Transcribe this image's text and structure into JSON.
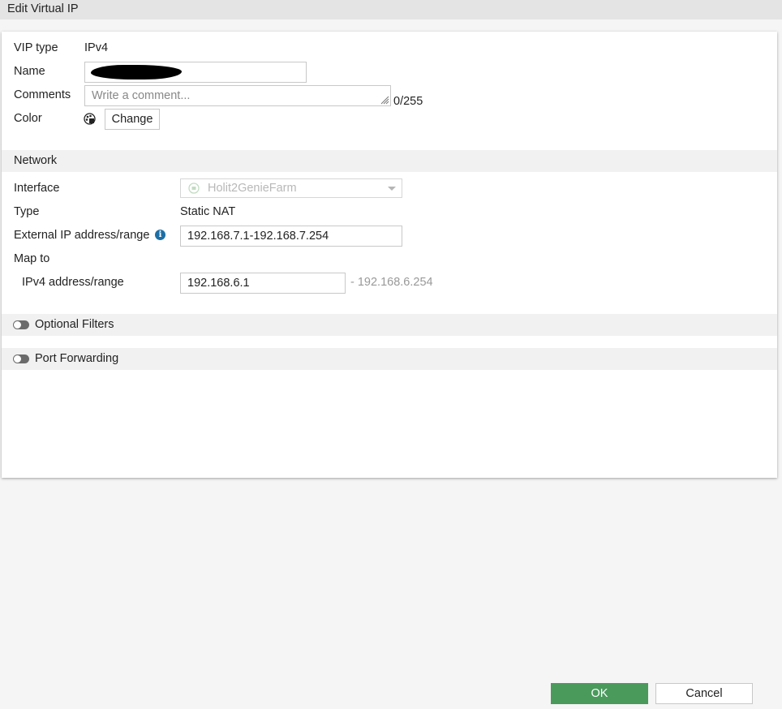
{
  "dialog": {
    "title": "Edit Virtual IP"
  },
  "general": {
    "vip_type_label": "VIP type",
    "vip_type_value": "IPv4",
    "name_label": "Name",
    "comments_label": "Comments",
    "comments_placeholder": "Write a comment...",
    "comments_count": "0/255",
    "color_label": "Color",
    "color_change_label": "Change"
  },
  "network": {
    "section_title": "Network",
    "interface_label": "Interface",
    "interface_value": "Holit2GenieFarm",
    "type_label": "Type",
    "type_value": "Static NAT",
    "external_ip_label": "External IP address/range",
    "external_ip_value": "192.168.7.1-192.168.7.254",
    "map_to_label": "Map to",
    "ipv4_range_label": "IPv4 address/range",
    "ipv4_range_value": "192.168.6.1",
    "ipv4_range_end": "- 192.168.6.254"
  },
  "optional_filters": {
    "label": "Optional Filters",
    "enabled": false
  },
  "port_forwarding": {
    "label": "Port Forwarding",
    "enabled": false
  },
  "footer": {
    "ok_label": "OK",
    "cancel_label": "Cancel"
  },
  "colors": {
    "ok_button": "#4a9a5c",
    "info_icon": "#1d6fa5",
    "toggle_off": "#6b6b6b"
  }
}
